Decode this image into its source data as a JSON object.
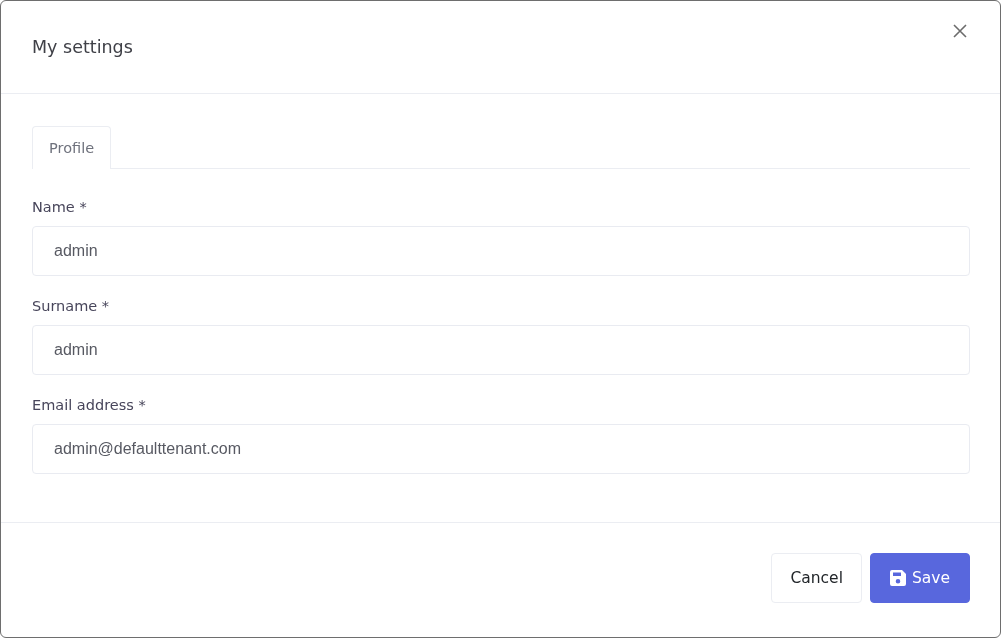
{
  "dialog": {
    "title": "My settings"
  },
  "tabs": [
    {
      "label": "Profile",
      "selected": true
    }
  ],
  "fields": [
    {
      "label": "Name *",
      "value": "admin"
    },
    {
      "label": "Surname *",
      "value": "admin"
    },
    {
      "label": "Email address *",
      "value": "admin@defaulttenant.com"
    }
  ],
  "buttons": [
    {
      "label": "Cancel",
      "kind": "secondary"
    },
    {
      "label": "Save",
      "kind": "primary"
    }
  ]
}
